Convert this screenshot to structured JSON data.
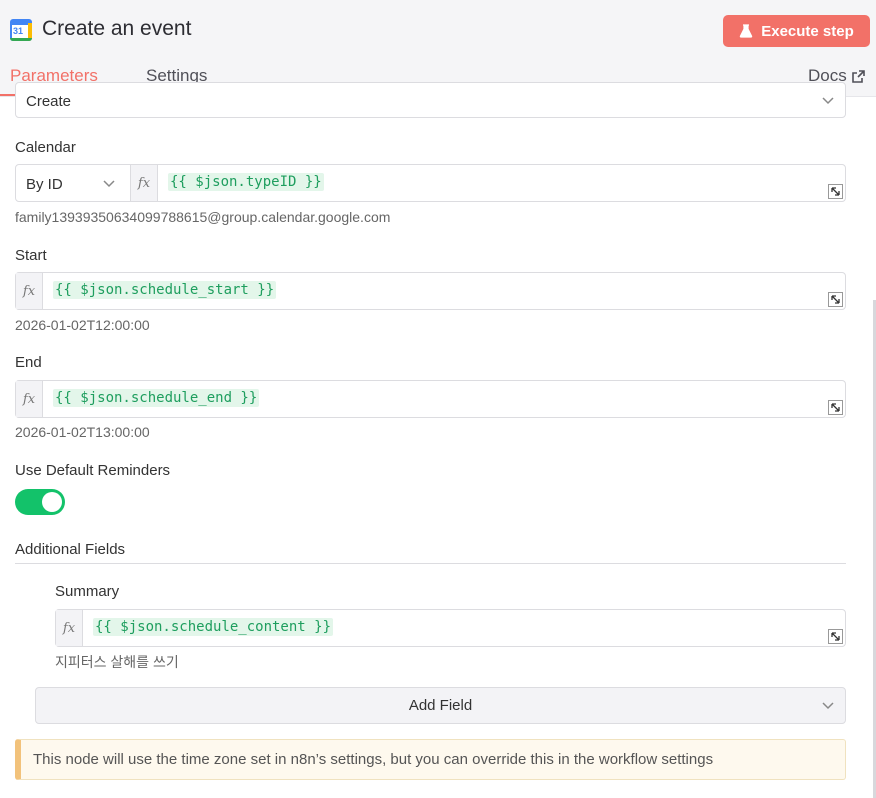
{
  "header": {
    "title": "Create an event",
    "app_icon_text": "31",
    "execute_label": "Execute step",
    "tabs": [
      {
        "label": "Parameters",
        "active": true
      },
      {
        "label": "Settings",
        "active": false
      }
    ],
    "docs_label": "Docs"
  },
  "form": {
    "operation_value": "Create",
    "calendar": {
      "label": "Calendar",
      "mode_value": "By ID",
      "expression": "{{ $json.typeID }}",
      "resolved": "family13939350634099788615@group.calendar.google.com"
    },
    "start": {
      "label": "Start",
      "expression": "{{ $json.schedule_start }}",
      "resolved": "2026-01-02T12:00:00"
    },
    "end": {
      "label": "End",
      "expression": "{{ $json.schedule_end }}",
      "resolved": "2026-01-02T13:00:00"
    },
    "reminders": {
      "label": "Use Default Reminders",
      "enabled": true
    },
    "additional_fields": {
      "label": "Additional Fields",
      "summary": {
        "label": "Summary",
        "expression": "{{ $json.schedule_content }}",
        "resolved": "지피터스 살해를 쓰기"
      },
      "add_field_label": "Add Field"
    },
    "fx_label": "fx",
    "notice": "This node will use the time zone set in n8n’s settings, but you can override this in the workflow settings"
  },
  "colors": {
    "accent": "#f27168",
    "toggle_on": "#13c26a",
    "expression_text": "#1e9e5e",
    "expression_bg": "#e3f6ea",
    "notice_border": "#f2c27b"
  }
}
